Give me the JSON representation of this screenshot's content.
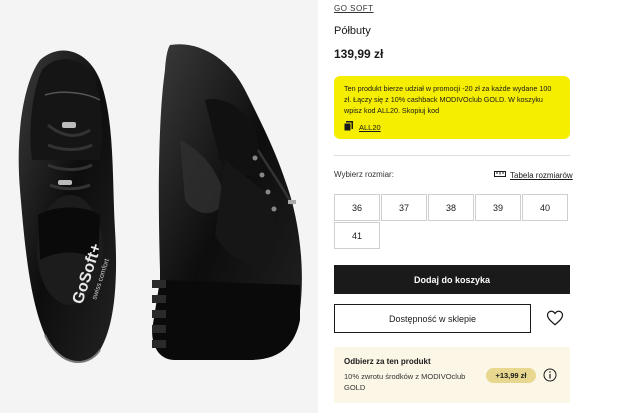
{
  "product": {
    "brand": "GO SOFT",
    "title": "Półbuty",
    "price": "139,99 zł",
    "shoe_logo": "GoSoft+",
    "shoe_tagline": "swiss comfort"
  },
  "promo": {
    "text": "Ten produkt bierze udział w promocji -20 zł za każde wydane 100 zł. Łączy się z 10% cashback MODIVOclub GOLD. W koszyku wpisz kod ALL20. Skopiuj kod",
    "code": "ALL20",
    "bg_color": "#f6ee00"
  },
  "sizes": {
    "label": "Wybierz rozmiar:",
    "table_link": "Tabela rozmiarów",
    "options": [
      "36",
      "37",
      "38",
      "39",
      "40",
      "41"
    ]
  },
  "actions": {
    "add_to_cart": "Dodaj do koszyka",
    "store_availability": "Dostępność w sklepie"
  },
  "reward": {
    "heading": "Odbierz za ten produkt",
    "description": "10% zwrotu środków z MODIVOclub GOLD",
    "amount": "+13,99 zł"
  }
}
